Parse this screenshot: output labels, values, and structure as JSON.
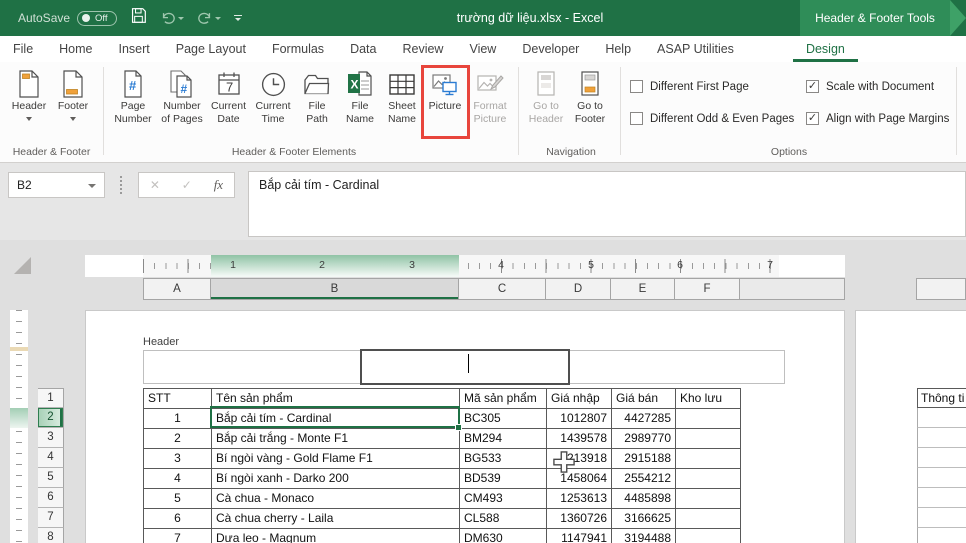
{
  "titlebar": {
    "autosave_label": "AutoSave",
    "autosave_state": "Off",
    "title": "trường dữ liệu.xlsx - Excel",
    "contextual_tab_title": "Header & Footer Tools"
  },
  "tabs": [
    {
      "label": "File"
    },
    {
      "label": "Home"
    },
    {
      "label": "Insert"
    },
    {
      "label": "Page Layout"
    },
    {
      "label": "Formulas"
    },
    {
      "label": "Data"
    },
    {
      "label": "Review"
    },
    {
      "label": "View"
    },
    {
      "label": "Developer"
    },
    {
      "label": "Help"
    },
    {
      "label": "ASAP Utilities"
    },
    {
      "label": "Design",
      "active": true
    }
  ],
  "ribbon": {
    "header_footer": {
      "group_label": "Header & Footer",
      "header": "Header",
      "footer": "Footer"
    },
    "elements": {
      "group_label": "Header & Footer Elements",
      "buttons": [
        {
          "line1": "Page",
          "line2": "Number"
        },
        {
          "line1": "Number",
          "line2": "of Pages"
        },
        {
          "line1": "Current",
          "line2": "Date"
        },
        {
          "line1": "Current",
          "line2": "Time"
        },
        {
          "line1": "File",
          "line2": "Path"
        },
        {
          "line1": "File",
          "line2": "Name"
        },
        {
          "line1": "Sheet",
          "line2": "Name"
        },
        {
          "line1": "Picture",
          "line2": "",
          "highlighted": true
        },
        {
          "line1": "Format",
          "line2": "Picture",
          "disabled": true
        }
      ]
    },
    "navigation": {
      "group_label": "Navigation",
      "goto_header": {
        "line1": "Go to",
        "line2": "Header",
        "disabled": true
      },
      "goto_footer": {
        "line1": "Go to",
        "line2": "Footer"
      }
    },
    "options": {
      "group_label": "Options",
      "checkboxes": [
        {
          "label": "Different First Page",
          "checked": false,
          "mark": ""
        },
        {
          "label": "Different Odd & Even Pages",
          "checked": false,
          "mark": ""
        },
        {
          "label": "Scale with Document",
          "checked": true,
          "mark": "✓"
        },
        {
          "label": "Align with Page Margins",
          "checked": true,
          "mark": "✓"
        }
      ]
    }
  },
  "formula_bar": {
    "name_box": "B2",
    "cancel_glyph": "✕",
    "enter_glyph": "✓",
    "fx_label": "fx",
    "formula": "Bắp cải tím - Cardinal"
  },
  "sheet": {
    "ruler_numbers": [
      "1",
      "2",
      "3",
      "4",
      "5",
      "6",
      "7"
    ],
    "columns": [
      "A",
      "B",
      "C",
      "D",
      "E",
      "F"
    ],
    "selected_column": "B",
    "rows": [
      "1",
      "2",
      "3",
      "4",
      "5",
      "6",
      "7",
      "8"
    ],
    "selected_row": "2",
    "selected_cell": "B2",
    "header_label": "Header",
    "table": {
      "headers": [
        "STT",
        "Tên sản phẩm",
        "Mã sản phẩm",
        "Giá nhập",
        "Giá bán",
        "Kho lưu"
      ],
      "rows": [
        [
          "1",
          "Bắp cải tím - Cardinal",
          "BC305",
          "1012807",
          "4427285",
          ""
        ],
        [
          "2",
          "Bắp cải trắng - Monte F1",
          "BM294",
          "1439578",
          "2989770",
          ""
        ],
        [
          "3",
          "Bí ngòi vàng - Gold Flame F1",
          "BG533",
          "1213918",
          "2915188",
          ""
        ],
        [
          "4",
          "Bí ngòi xanh - Darko 200",
          "BD539",
          "1458064",
          "2554212",
          ""
        ],
        [
          "5",
          "Cà chua - Monaco",
          "CM493",
          "1253613",
          "4485898",
          ""
        ],
        [
          "6",
          "Cà chua cherry - Laila",
          "CL588",
          "1360726",
          "3166625",
          ""
        ],
        [
          "7",
          "Dưa leo - Magnum",
          "DM630",
          "1147941",
          "3194488",
          ""
        ]
      ]
    },
    "page2_table_header": "Thông ti"
  },
  "colors": {
    "titlebar_green": "#1f7145",
    "accent_green": "#217346",
    "highlight_red": "#e8453c"
  }
}
